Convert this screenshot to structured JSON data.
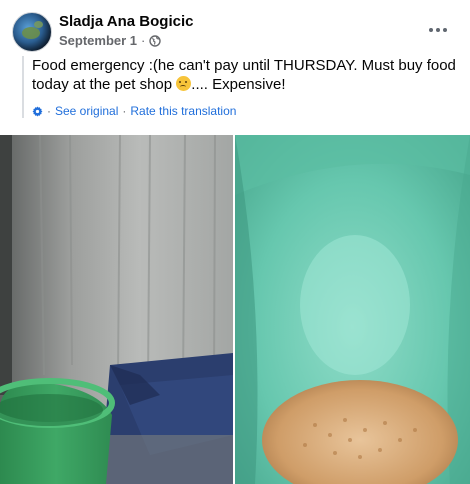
{
  "post": {
    "author": "Sladja Ana Bogicic",
    "date": "September 1",
    "date_separator": "·",
    "privacy_icon": "globe-icon",
    "more_icon": "more-options-icon",
    "text_part1": "Food emergency :(he can't pay until THURSDAY. Must buy food today at the pet shop ",
    "emoji": "weary-face-emoji",
    "text_part2": ".... Expensive!",
    "translation": {
      "settings_icon": "gear-icon",
      "separator": "·",
      "see_original": "See original",
      "rate_translation": "Rate this translation"
    },
    "photos": [
      {
        "description_icon": "photo",
        "subject": "green plastic bucket by a wall with a blue blanket"
      },
      {
        "description_icon": "photo",
        "subject": "inside of green bucket with dry pet food"
      }
    ]
  },
  "colors": {
    "link": "#216fdb",
    "secondary_text": "#65676b",
    "primary_text": "#050505",
    "bucket_green": "#3fa866",
    "bucket_inner": "#5fc0a8"
  }
}
